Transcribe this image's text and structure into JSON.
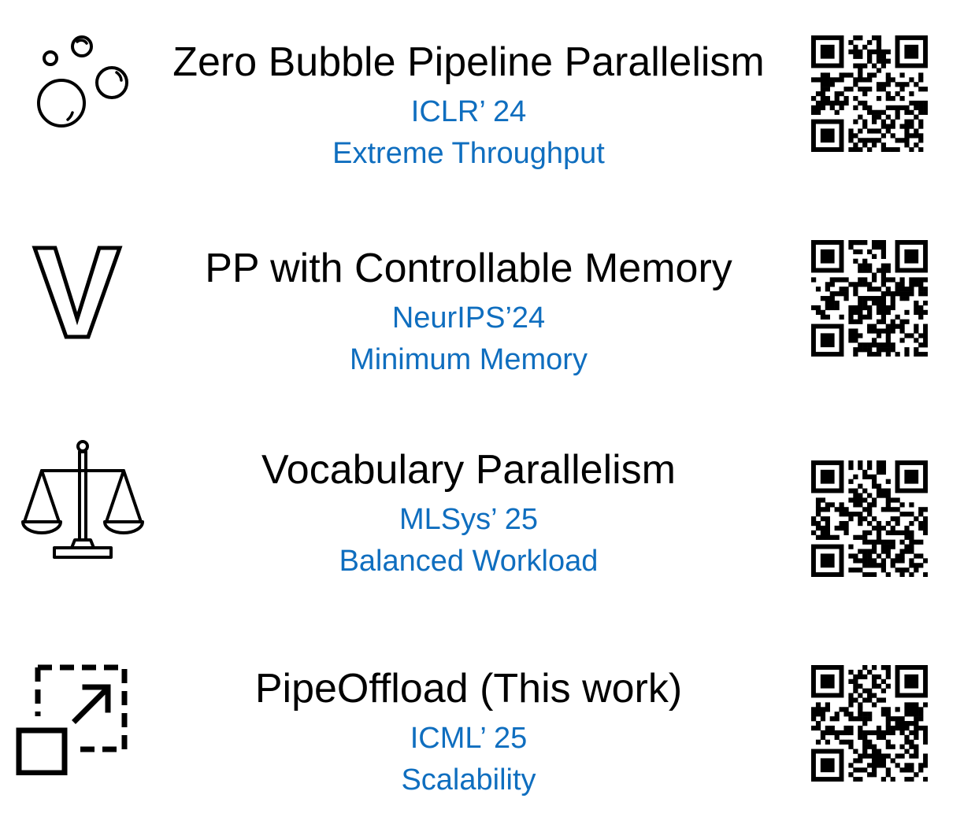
{
  "colors": {
    "title": "#000000",
    "subtitle": "#0f6ebf",
    "background": "#ffffff"
  },
  "items": [
    {
      "icon": "bubbles-icon",
      "title": "Zero Bubble Pipeline Parallelism",
      "venue": "ICLR’ 24",
      "tagline": "Extreme Throughput"
    },
    {
      "icon": "v-letter-icon",
      "title": "PP with Controllable Memory",
      "venue": "NeurIPS’24",
      "tagline": "Minimum Memory"
    },
    {
      "icon": "balance-scale-icon",
      "title": "Vocabulary Parallelism",
      "venue": "MLSys’ 25",
      "tagline": "Balanced Workload"
    },
    {
      "icon": "expand-offload-icon",
      "title": "PipeOffload (This work)",
      "venue": "ICML’ 25",
      "tagline": "Scalability"
    }
  ]
}
